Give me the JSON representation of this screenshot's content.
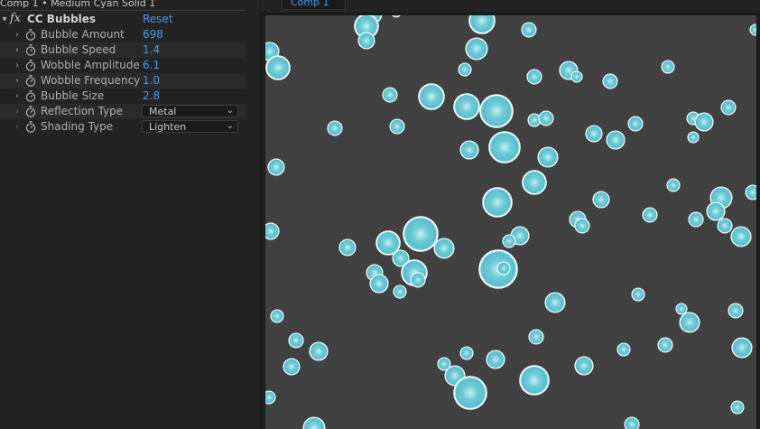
{
  "panel": {
    "title": "Comp 1 • Medium Cyan Solid 1",
    "effect": {
      "fx_label": "fx",
      "name": "CC Bubbles",
      "reset_label": "Reset"
    },
    "properties": [
      {
        "label": "Bubble Amount",
        "value": "698"
      },
      {
        "label": "Bubble Speed",
        "value": "1.4"
      },
      {
        "label": "Wobble Amplitude",
        "value": "6.1"
      },
      {
        "label": "Wobble Frequency",
        "value": "1.0"
      },
      {
        "label": "Bubble Size",
        "value": "2.8"
      }
    ],
    "dropdowns": [
      {
        "label": "Reflection Type",
        "value": "Metal"
      },
      {
        "label": "Shading Type",
        "value": "Lighten"
      }
    ]
  },
  "viewer": {
    "tab_label": "Comp 1"
  },
  "colors": {
    "accent": "#3d9bf0",
    "bubble": "#5fc3cf",
    "bubble_highlight": "#ffffff",
    "canvas_bg": "#414141",
    "panel_bg": "#232323"
  },
  "icons": {
    "twirl_open": "▾",
    "twirl_closed": "›",
    "dropdown": "chevron-down-icon",
    "stopwatch": "stopwatch-icon"
  }
}
